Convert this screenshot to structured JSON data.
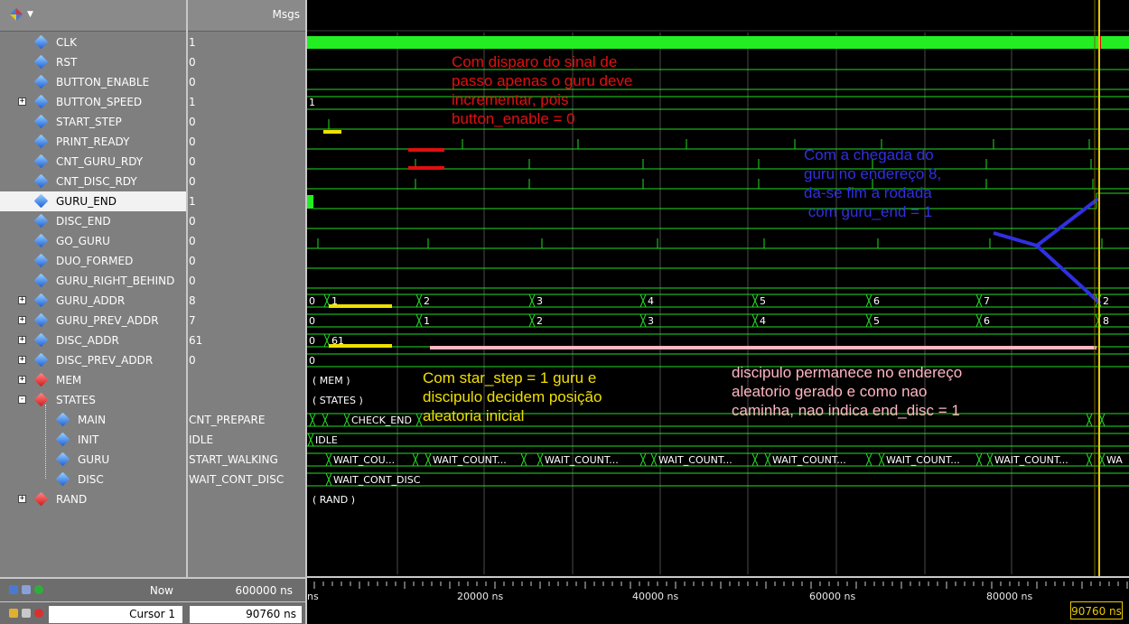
{
  "header": {
    "msgs": "Msgs"
  },
  "signals": [
    {
      "name": "CLK",
      "value": "1",
      "expand": "",
      "icon": "blue"
    },
    {
      "name": "RST",
      "value": "0",
      "expand": "",
      "icon": "blue"
    },
    {
      "name": "BUTTON_ENABLE",
      "value": "0",
      "expand": "",
      "icon": "blue"
    },
    {
      "name": "BUTTON_SPEED",
      "value": "1",
      "expand": "+",
      "icon": "blue"
    },
    {
      "name": "START_STEP",
      "value": "0",
      "expand": "",
      "icon": "blue"
    },
    {
      "name": "PRINT_READY",
      "value": "0",
      "expand": "",
      "icon": "blue"
    },
    {
      "name": "CNT_GURU_RDY",
      "value": "0",
      "expand": "",
      "icon": "blue"
    },
    {
      "name": "CNT_DISC_RDY",
      "value": "0",
      "expand": "",
      "icon": "blue"
    },
    {
      "name": "GURU_END",
      "value": "1",
      "expand": "",
      "icon": "blue"
    },
    {
      "name": "DISC_END",
      "value": "0",
      "expand": "",
      "icon": "blue"
    },
    {
      "name": "GO_GURU",
      "value": "0",
      "expand": "",
      "icon": "blue"
    },
    {
      "name": "DUO_FORMED",
      "value": "0",
      "expand": "",
      "icon": "blue"
    },
    {
      "name": "GURU_RIGHT_BEHIND",
      "value": "0",
      "expand": "",
      "icon": "blue"
    },
    {
      "name": "GURU_ADDR",
      "value": "8",
      "expand": "+",
      "icon": "blue"
    },
    {
      "name": "GURU_PREV_ADDR",
      "value": "7",
      "expand": "+",
      "icon": "blue"
    },
    {
      "name": "DISC_ADDR",
      "value": "61",
      "expand": "+",
      "icon": "blue"
    },
    {
      "name": "DISC_PREV_ADDR",
      "value": "0",
      "expand": "+",
      "icon": "blue"
    },
    {
      "name": "MEM",
      "value": "",
      "expand": "+",
      "icon": "red"
    },
    {
      "name": "STATES",
      "value": "",
      "expand": "-",
      "icon": "red"
    },
    {
      "name": "MAIN",
      "value": "CNT_PREPARE",
      "expand": "",
      "icon": "blue",
      "child": true
    },
    {
      "name": "INIT",
      "value": "IDLE",
      "expand": "",
      "icon": "blue",
      "child": true
    },
    {
      "name": "GURU",
      "value": "START_WALKING",
      "expand": "",
      "icon": "blue",
      "child": true
    },
    {
      "name": "DISC",
      "value": "WAIT_CONT_DISC",
      "expand": "",
      "icon": "blue",
      "child": true
    },
    {
      "name": "RAND",
      "value": "",
      "expand": "+",
      "icon": "red"
    }
  ],
  "wave_labels": {
    "button_speed": "1",
    "guru_addr": [
      "0",
      "1",
      "2",
      "3",
      "4",
      "5",
      "6",
      "7",
      "2"
    ],
    "guru_prev_addr": [
      "0",
      "1",
      "2",
      "3",
      "4",
      "5",
      "6",
      "8"
    ],
    "disc_addr": [
      "0",
      "61"
    ],
    "disc_prev_addr": "0",
    "mem": "( MEM )",
    "states": "( STATES )",
    "main": "CHECK_END",
    "init": "IDLE",
    "guru": [
      "WAIT_COU...",
      "WAIT_COUNT...",
      "WAIT_COUNT...",
      "WAIT_COUNT...",
      "WAIT_COUNT...",
      "WAIT_COUNT...",
      "WAIT_COUNT...",
      "WA"
    ],
    "disc": "WAIT_CONT_DISC",
    "rand": "( RAND )"
  },
  "timeline": {
    "now_label": "Now",
    "now_value": "600000 ns",
    "cursor_label": "Cursor 1",
    "cursor_value": "90760 ns",
    "cursor_flag": "90760 ns",
    "ticks": [
      "ns",
      "20000 ns",
      "40000 ns",
      "60000 ns",
      "80000 ns"
    ]
  },
  "annotations": {
    "red": "Com disparo do sinal de\npasso apenas o guru deve\nincrementar, pois\nbutton_enable = 0",
    "blue": "Com a chegada do\nguru no endereço 8,\nda-se fim a rodada\n com guru_end = 1",
    "yellow": "Com star_step = 1 guru e\ndiscipulo decidem posição\naleatoria inicial",
    "pink": "discipulo permanece no endereço\naleatorio gerado e como nao\ncaminha, nao indica end_disc = 1"
  },
  "colors": {
    "wave_green": "#22dd22",
    "cursor_yellow": "#e8c800",
    "note_red": "#e01010",
    "note_blue": "#3030e0",
    "note_yellow": "#f0e000",
    "note_pink": "#ffb6c1"
  }
}
